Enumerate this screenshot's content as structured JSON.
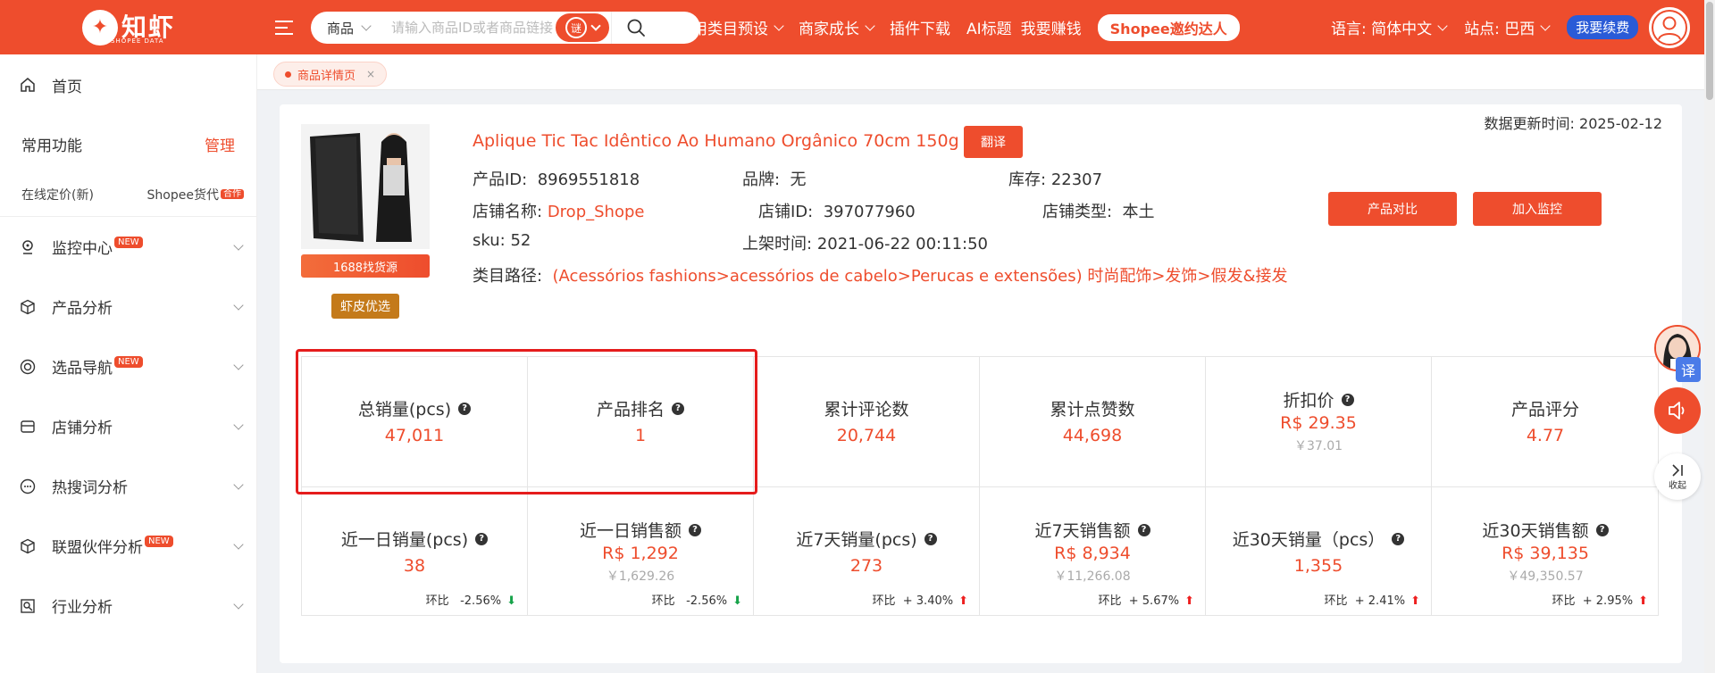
{
  "header": {
    "logo_text": "知虾",
    "logo_sub": "SHOPEE DATA",
    "search": {
      "type_label": "商品",
      "placeholder": "请输入商品ID或者商品链接",
      "mode_badge": "谜"
    },
    "nav": [
      {
        "label": "常用类目预设",
        "has_dropdown": true
      },
      {
        "label": "商家成长",
        "has_dropdown": true
      },
      {
        "label": "插件下载",
        "has_dropdown": false
      },
      {
        "label": "AI标题",
        "has_dropdown": false
      },
      {
        "label": "我要赚钱",
        "has_dropdown": false
      }
    ],
    "promo_pill": "Shopee邀约达人",
    "language": "语言: 简体中文",
    "site": "站点: 巴西",
    "renew_button": "我要续费"
  },
  "sidebar": {
    "home": "首页",
    "common": "常用功能",
    "manage": "管理",
    "sub_item": "在线定价(新)",
    "sub_item_right": "Shopee货代",
    "sub_item_tag": "合作",
    "groups": [
      {
        "label": "监控中心",
        "badge": "NEW",
        "icon": "monitor-icon"
      },
      {
        "label": "产品分析",
        "badge": "",
        "icon": "box-icon"
      },
      {
        "label": "选品导航",
        "badge": "NEW",
        "icon": "compass-icon"
      },
      {
        "label": "店铺分析",
        "badge": "",
        "icon": "store-icon"
      },
      {
        "label": "热搜词分析",
        "badge": "",
        "icon": "chat-icon"
      },
      {
        "label": "联盟伙伴分析",
        "badge": "NEW",
        "icon": "partner-icon"
      },
      {
        "label": "行业分析",
        "badge": "",
        "icon": "chart-icon"
      }
    ]
  },
  "tabs": [
    {
      "label": "商品详情页",
      "close": "×"
    }
  ],
  "product": {
    "updated_label": "数据更新时间: 2025-02-12",
    "source_button": "1688找货源",
    "pick_badge": "虾皮优选",
    "title": "Aplique Tic Tac Idêntico Ao Humano Orgânico 70cm 150g",
    "translate_button": "翻译",
    "id_label": "产品ID:",
    "id_value": "8969551818",
    "brand_label": "品牌:",
    "brand_value": "无",
    "stock_label": "库存:",
    "stock_value": "22307",
    "shop_name_label": "店铺名称:",
    "shop_name_value": "Drop_Shope",
    "shop_id_label": "店铺ID:",
    "shop_id_value": "397077960",
    "shop_type_label": "店铺类型:",
    "shop_type_value": "本土",
    "sku_label": "sku:",
    "sku_value": "52",
    "listed_label": "上架时间:",
    "listed_value": "2021-06-22 00:11:50",
    "category_label": "类目路径:",
    "category_value": "(Acessórios fashions>acessórios de cabelo>Perucas e extensões) 时尚配饰>发饰>假发&接发",
    "compare_button": "产品对比",
    "monitor_button": "加入监控"
  },
  "metrics_row1": [
    {
      "label": "总销量(pcs)",
      "value": "47,011",
      "help": true,
      "sub": ""
    },
    {
      "label": "产品排名",
      "value": "1",
      "help": true,
      "sub": ""
    },
    {
      "label": "累计评论数",
      "value": "20,744",
      "help": false,
      "sub": ""
    },
    {
      "label": "累计点赞数",
      "value": "44,698",
      "help": false,
      "sub": ""
    },
    {
      "label": "折扣价",
      "value": "R$ 29.35",
      "help": true,
      "sub": "￥37.01"
    },
    {
      "label": "产品评分",
      "value": "4.77",
      "help": false,
      "sub": ""
    }
  ],
  "metrics_row2": [
    {
      "label": "近一日销量(pcs)",
      "value": "38",
      "help": true,
      "sub": "",
      "ring_label": "环比",
      "ring_value": "-2.56%",
      "trend": "down"
    },
    {
      "label": "近一日销售额",
      "value": "R$ 1,292",
      "help": true,
      "sub": "￥1,629.26",
      "ring_label": "环比",
      "ring_value": "-2.56%",
      "trend": "down"
    },
    {
      "label": "近7天销量(pcs)",
      "value": "273",
      "help": true,
      "sub": "",
      "ring_label": "环比",
      "ring_value": "+ 3.40%",
      "trend": "up"
    },
    {
      "label": "近7天销售额",
      "value": "R$ 8,934",
      "help": true,
      "sub": "￥11,266.08",
      "ring_label": "环比",
      "ring_value": "+ 5.67%",
      "trend": "up"
    },
    {
      "label": "近30天销量（pcs）",
      "value": "1,355",
      "help": true,
      "sub": "",
      "ring_label": "环比",
      "ring_value": "+ 2.41%",
      "trend": "up"
    },
    {
      "label": "近30天销售额",
      "value": "R$ 39,135",
      "help": true,
      "sub": "￥49,350.57",
      "ring_label": "环比",
      "ring_value": "+ 2.95%",
      "trend": "up"
    }
  ],
  "float_tools": {
    "translate_badge": "译",
    "collapse_label": "收起"
  },
  "colors": {
    "brand": "#ee4d2d",
    "renew": "#2a5bd7",
    "highlight": "#e51c1c",
    "trend_up": "#ee2020",
    "trend_down": "#17a34a"
  }
}
